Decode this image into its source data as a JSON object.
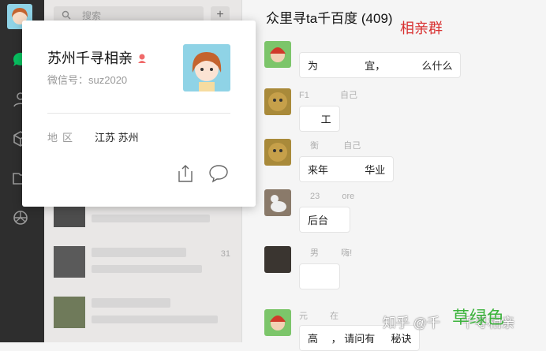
{
  "search": {
    "placeholder": "搜索",
    "add_symbol": "+"
  },
  "chat": {
    "title": "众里寻ta千百度 (409)",
    "annotation_red": "相亲群",
    "messages": [
      {
        "name": "",
        "text": "为 　　　　 宜， 　　　 么什么"
      },
      {
        "name": "F1 　　　 自己",
        "text": "　 工"
      },
      {
        "name": "　 衡 　 　 自己",
        "text": "来年 　　　 华业"
      },
      {
        "name": "　 23 　　 ore",
        "text": "后台 　"
      },
      {
        "name": "　 男 　　 嗨!",
        "text": "　 　"
      },
      {
        "name": "元 　　 在",
        "text": "高 　， 请问有 　 秘诀"
      }
    ]
  },
  "popup": {
    "name": "苏州千寻相亲",
    "wechat_id": "微信号：suz2020",
    "region_label": "地区",
    "region_value": "江苏 苏州"
  },
  "list": {
    "times": [
      "31"
    ]
  },
  "watermark": {
    "text": "知乎 @千 　 千寻相亲",
    "annotation_green": "草绿色"
  }
}
